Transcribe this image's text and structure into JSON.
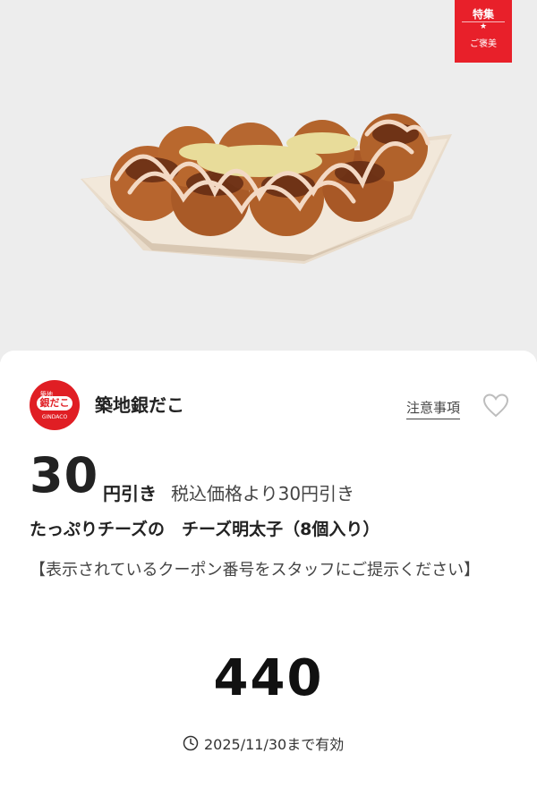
{
  "ribbon": {
    "top": "特集",
    "bottom": "ご褒美"
  },
  "store": {
    "name": "築地銀だこ",
    "logo_caption": "築地",
    "logo_mark": "銀だこ",
    "logo_en": "GINDACO"
  },
  "notes_link": "注意事項",
  "discount": {
    "amount": "30",
    "unit": "円引き",
    "description": "税込価格より30円引き"
  },
  "product": "たっぷりチーズの　チーズ明太子（8個入り）",
  "instructions": "【表示されているクーポン番号をスタッフにご提示ください】",
  "coupon_code": "440",
  "expiry": "2025/11/30まで有効",
  "icons": {
    "heart": "heart-icon",
    "clock": "clock-icon"
  },
  "colors": {
    "accent": "#e8202a",
    "hero_bg": "#ededed"
  }
}
